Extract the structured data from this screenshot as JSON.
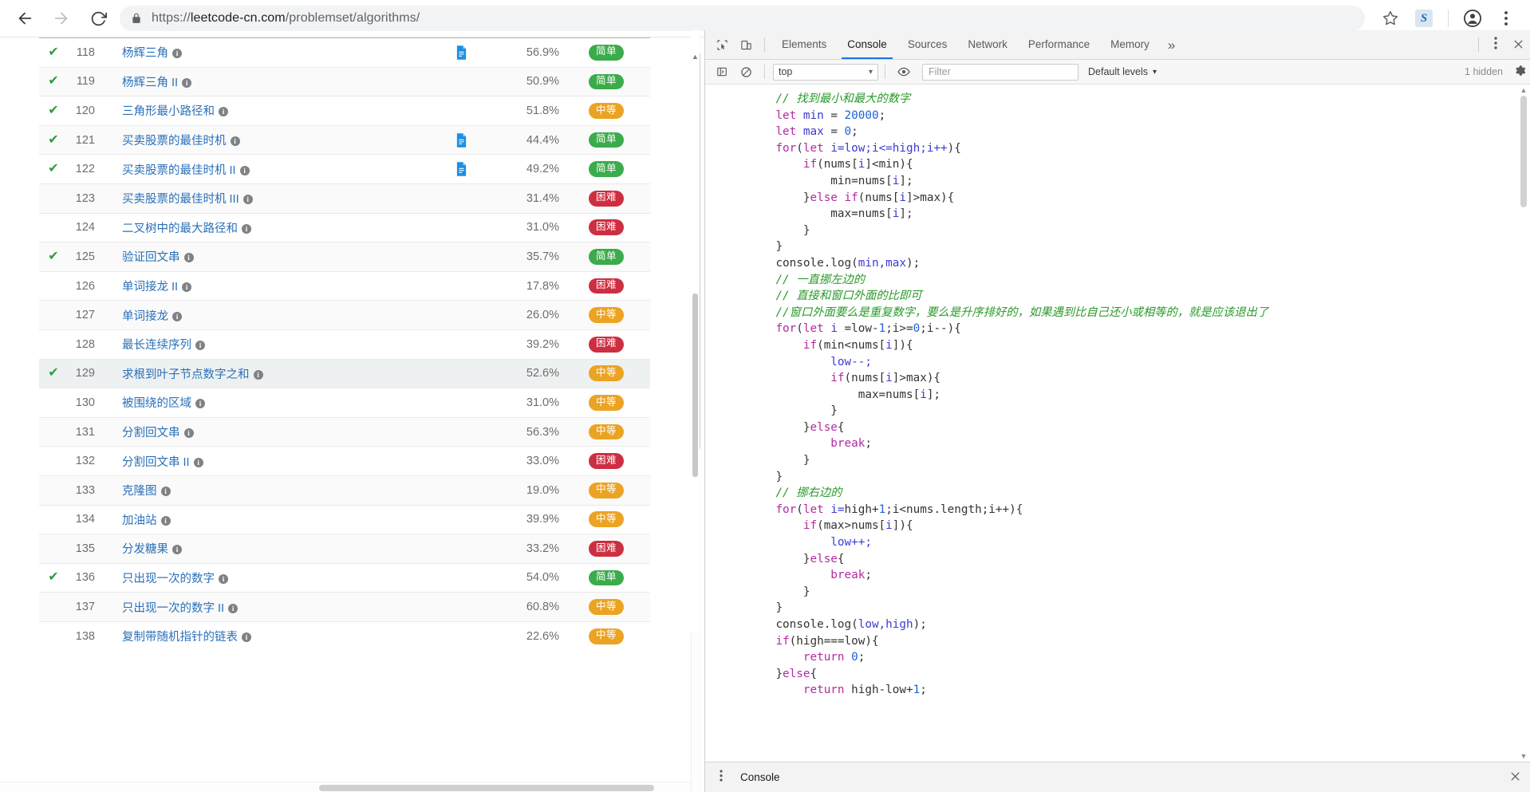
{
  "browser": {
    "back_icon": "back-arrow-icon",
    "forward_icon": "forward-arrow-icon",
    "reload_icon": "reload-icon",
    "lock_icon": "lock-icon",
    "url_scheme": "https://",
    "url_host": "leetcode-cn.com",
    "url_path": "/problemset/algorithms/",
    "bookmark_icon": "star-icon",
    "extension_label": "S",
    "profile_icon": "account-icon",
    "menu_icon": "three-dot-menu-icon"
  },
  "problems": {
    "columns": [
      "status",
      "id",
      "title",
      "solution",
      "acceptance",
      "difficulty"
    ],
    "rows": [
      {
        "solved": true,
        "id": "118",
        "title": "杨辉三角",
        "has_solution": true,
        "rate": "56.9%",
        "difficulty": "简单",
        "level": "easy"
      },
      {
        "solved": true,
        "id": "119",
        "title": "杨辉三角 II",
        "has_solution": false,
        "rate": "50.9%",
        "difficulty": "简单",
        "level": "easy"
      },
      {
        "solved": true,
        "id": "120",
        "title": "三角形最小路径和",
        "has_solution": false,
        "rate": "51.8%",
        "difficulty": "中等",
        "level": "medium"
      },
      {
        "solved": true,
        "id": "121",
        "title": "买卖股票的最佳时机",
        "has_solution": true,
        "rate": "44.4%",
        "difficulty": "简单",
        "level": "easy"
      },
      {
        "solved": true,
        "id": "122",
        "title": "买卖股票的最佳时机 II",
        "has_solution": true,
        "rate": "49.2%",
        "difficulty": "简单",
        "level": "easy"
      },
      {
        "solved": false,
        "id": "123",
        "title": "买卖股票的最佳时机 III",
        "has_solution": false,
        "rate": "31.4%",
        "difficulty": "困难",
        "level": "hard"
      },
      {
        "solved": false,
        "id": "124",
        "title": "二叉树中的最大路径和",
        "has_solution": false,
        "rate": "31.0%",
        "difficulty": "困难",
        "level": "hard"
      },
      {
        "solved": true,
        "id": "125",
        "title": "验证回文串",
        "has_solution": false,
        "rate": "35.7%",
        "difficulty": "简单",
        "level": "easy"
      },
      {
        "solved": false,
        "id": "126",
        "title": "单词接龙 II",
        "has_solution": false,
        "rate": "17.8%",
        "difficulty": "困难",
        "level": "hard"
      },
      {
        "solved": false,
        "id": "127",
        "title": "单词接龙",
        "has_solution": false,
        "rate": "26.0%",
        "difficulty": "中等",
        "level": "medium"
      },
      {
        "solved": false,
        "id": "128",
        "title": "最长连续序列",
        "has_solution": false,
        "rate": "39.2%",
        "difficulty": "困难",
        "level": "hard"
      },
      {
        "solved": true,
        "id": "129",
        "title": "求根到叶子节点数字之和",
        "has_solution": false,
        "rate": "52.6%",
        "difficulty": "中等",
        "level": "medium"
      },
      {
        "solved": false,
        "id": "130",
        "title": "被围绕的区域",
        "has_solution": false,
        "rate": "31.0%",
        "difficulty": "中等",
        "level": "medium"
      },
      {
        "solved": false,
        "id": "131",
        "title": "分割回文串",
        "has_solution": false,
        "rate": "56.3%",
        "difficulty": "中等",
        "level": "medium"
      },
      {
        "solved": false,
        "id": "132",
        "title": "分割回文串 II",
        "has_solution": false,
        "rate": "33.0%",
        "difficulty": "困难",
        "level": "hard"
      },
      {
        "solved": false,
        "id": "133",
        "title": "克隆图",
        "has_solution": false,
        "rate": "19.0%",
        "difficulty": "中等",
        "level": "medium"
      },
      {
        "solved": false,
        "id": "134",
        "title": "加油站",
        "has_solution": false,
        "rate": "39.9%",
        "difficulty": "中等",
        "level": "medium"
      },
      {
        "solved": false,
        "id": "135",
        "title": "分发糖果",
        "has_solution": false,
        "rate": "33.2%",
        "difficulty": "困难",
        "level": "hard"
      },
      {
        "solved": true,
        "id": "136",
        "title": "只出现一次的数字",
        "has_solution": false,
        "rate": "54.0%",
        "difficulty": "简单",
        "level": "easy"
      },
      {
        "solved": false,
        "id": "137",
        "title": "只出现一次的数字 II",
        "has_solution": false,
        "rate": "60.8%",
        "difficulty": "中等",
        "level": "medium"
      },
      {
        "solved": false,
        "id": "138",
        "title": "复制带随机指针的链表",
        "has_solution": false,
        "rate": "22.6%",
        "difficulty": "中等",
        "level": "medium"
      }
    ],
    "colors": {
      "easy": "#3bab4b",
      "medium": "#eba324",
      "hard": "#cc2f41",
      "title_link": "#2a70b8",
      "check": "#2e9c3f"
    }
  },
  "devtools": {
    "inspect_icon": "cursor-inspect-icon",
    "device_icon": "device-toolbar-icon",
    "tabs": [
      {
        "label": "Elements",
        "active": false
      },
      {
        "label": "Console",
        "active": true
      },
      {
        "label": "Sources",
        "active": false
      },
      {
        "label": "Network",
        "active": false
      },
      {
        "label": "Performance",
        "active": false
      },
      {
        "label": "Memory",
        "active": false
      }
    ],
    "more_tabs_icon": "chevron-double-right-icon",
    "settings_kebab_icon": "vertical-dots-icon",
    "close_icon": "close-icon",
    "toolbar": {
      "sidebar_icon": "console-sidebar-icon",
      "clear_icon": "clear-console-icon",
      "context": "top",
      "context_caret": "▾",
      "eye_icon": "live-expression-icon",
      "filter_placeholder": "Filter",
      "levels_label": "Default levels",
      "levels_caret": "▾",
      "hidden_label": "1 hidden",
      "gear_icon": "settings-gear-icon"
    },
    "code_lines": [
      {
        "indent": 4,
        "parts": [
          {
            "t": "// 找到最小和最大的数字",
            "c": "cm"
          }
        ]
      },
      {
        "indent": 4,
        "parts": [
          {
            "t": "let ",
            "c": "kw"
          },
          {
            "t": "min ",
            "c": "nm"
          },
          {
            "t": "= ",
            "c": "pl"
          },
          {
            "t": "20000",
            "c": "num"
          },
          {
            "t": ";",
            "c": "pl"
          }
        ]
      },
      {
        "indent": 4,
        "parts": [
          {
            "t": "let ",
            "c": "kw"
          },
          {
            "t": "max ",
            "c": "nm"
          },
          {
            "t": "= ",
            "c": "pl"
          },
          {
            "t": "0",
            "c": "num"
          },
          {
            "t": ";",
            "c": "pl"
          }
        ]
      },
      {
        "indent": 4,
        "parts": [
          {
            "t": "for",
            "c": "kw"
          },
          {
            "t": "(",
            "c": "pl"
          },
          {
            "t": "let ",
            "c": "kw"
          },
          {
            "t": "i=",
            "c": "nm"
          },
          {
            "t": "low;i<=high;i++",
            "c": "nm"
          },
          {
            "t": "){",
            "c": "pl"
          }
        ]
      },
      {
        "indent": 8,
        "parts": [
          {
            "t": "if",
            "c": "kw"
          },
          {
            "t": "(nums[",
            "c": "pl"
          },
          {
            "t": "i",
            "c": "nm"
          },
          {
            "t": "]<min){",
            "c": "pl"
          }
        ]
      },
      {
        "indent": 12,
        "parts": [
          {
            "t": "min=nums[",
            "c": "pl"
          },
          {
            "t": "i",
            "c": "nm"
          },
          {
            "t": "];",
            "c": "pl"
          }
        ]
      },
      {
        "indent": 8,
        "parts": [
          {
            "t": "}",
            "c": "pl"
          },
          {
            "t": "else if",
            "c": "kw"
          },
          {
            "t": "(nums[",
            "c": "pl"
          },
          {
            "t": "i",
            "c": "nm"
          },
          {
            "t": "]>max){",
            "c": "pl"
          }
        ]
      },
      {
        "indent": 12,
        "parts": [
          {
            "t": "max=nums[",
            "c": "pl"
          },
          {
            "t": "i",
            "c": "nm"
          },
          {
            "t": "];",
            "c": "pl"
          }
        ]
      },
      {
        "indent": 8,
        "parts": [
          {
            "t": "}",
            "c": "pl"
          }
        ]
      },
      {
        "indent": 4,
        "parts": [
          {
            "t": "}",
            "c": "pl"
          }
        ]
      },
      {
        "indent": 0,
        "parts": [
          {
            "t": "",
            "c": "pl"
          }
        ]
      },
      {
        "indent": 4,
        "parts": [
          {
            "t": "console.log(",
            "c": "pl"
          },
          {
            "t": "min,max",
            "c": "nm"
          },
          {
            "t": ");",
            "c": "pl"
          }
        ]
      },
      {
        "indent": 0,
        "parts": [
          {
            "t": "",
            "c": "pl"
          }
        ]
      },
      {
        "indent": 0,
        "parts": [
          {
            "t": "",
            "c": "pl"
          }
        ]
      },
      {
        "indent": 4,
        "parts": [
          {
            "t": "// 一直挪左边的",
            "c": "cm"
          }
        ]
      },
      {
        "indent": 4,
        "parts": [
          {
            "t": "// 直接和窗口外面的比即可",
            "c": "cm"
          }
        ]
      },
      {
        "indent": 4,
        "parts": [
          {
            "t": "//窗口外面要么是重复数字，要么是升序排好的，如果遇到比自己还小或相等的，就是应该退出了",
            "c": "cm"
          }
        ]
      },
      {
        "indent": 4,
        "parts": [
          {
            "t": "for",
            "c": "kw"
          },
          {
            "t": "(",
            "c": "pl"
          },
          {
            "t": "let ",
            "c": "kw"
          },
          {
            "t": "i ",
            "c": "nm"
          },
          {
            "t": "=low-",
            "c": "pl"
          },
          {
            "t": "1",
            "c": "num"
          },
          {
            "t": ";i>=",
            "c": "pl"
          },
          {
            "t": "0",
            "c": "num"
          },
          {
            "t": ";i--){",
            "c": "pl"
          }
        ]
      },
      {
        "indent": 8,
        "parts": [
          {
            "t": "if",
            "c": "kw"
          },
          {
            "t": "(min<nums[",
            "c": "pl"
          },
          {
            "t": "i",
            "c": "nm"
          },
          {
            "t": "]){",
            "c": "pl"
          }
        ]
      },
      {
        "indent": 12,
        "parts": [
          {
            "t": "low--;",
            "c": "nm"
          }
        ]
      },
      {
        "indent": 12,
        "parts": [
          {
            "t": "if",
            "c": "kw"
          },
          {
            "t": "(nums[",
            "c": "pl"
          },
          {
            "t": "i",
            "c": "nm"
          },
          {
            "t": "]>max){",
            "c": "pl"
          }
        ]
      },
      {
        "indent": 16,
        "parts": [
          {
            "t": "max=nums[",
            "c": "pl"
          },
          {
            "t": "i",
            "c": "nm"
          },
          {
            "t": "];",
            "c": "pl"
          }
        ]
      },
      {
        "indent": 12,
        "parts": [
          {
            "t": "}",
            "c": "pl"
          }
        ]
      },
      {
        "indent": 8,
        "parts": [
          {
            "t": "}",
            "c": "pl"
          },
          {
            "t": "else",
            "c": "kw"
          },
          {
            "t": "{",
            "c": "pl"
          }
        ]
      },
      {
        "indent": 12,
        "parts": [
          {
            "t": "break",
            "c": "kw"
          },
          {
            "t": ";",
            "c": "pl"
          }
        ]
      },
      {
        "indent": 8,
        "parts": [
          {
            "t": "}",
            "c": "pl"
          }
        ]
      },
      {
        "indent": 4,
        "parts": [
          {
            "t": "}",
            "c": "pl"
          }
        ]
      },
      {
        "indent": 0,
        "parts": [
          {
            "t": "",
            "c": "pl"
          }
        ]
      },
      {
        "indent": 0,
        "parts": [
          {
            "t": "",
            "c": "pl"
          }
        ]
      },
      {
        "indent": 4,
        "parts": [
          {
            "t": "// 挪右边的",
            "c": "cm"
          }
        ]
      },
      {
        "indent": 4,
        "parts": [
          {
            "t": "for",
            "c": "kw"
          },
          {
            "t": "(",
            "c": "pl"
          },
          {
            "t": "let ",
            "c": "kw"
          },
          {
            "t": "i=",
            "c": "nm"
          },
          {
            "t": "high+",
            "c": "pl"
          },
          {
            "t": "1",
            "c": "num"
          },
          {
            "t": ";i<nums.length;i++){",
            "c": "pl"
          }
        ]
      },
      {
        "indent": 8,
        "parts": [
          {
            "t": "if",
            "c": "kw"
          },
          {
            "t": "(max>nums[",
            "c": "pl"
          },
          {
            "t": "i",
            "c": "nm"
          },
          {
            "t": "]){",
            "c": "pl"
          }
        ]
      },
      {
        "indent": 12,
        "parts": [
          {
            "t": "low++;",
            "c": "nm"
          }
        ]
      },
      {
        "indent": 8,
        "parts": [
          {
            "t": "}",
            "c": "pl"
          },
          {
            "t": "else",
            "c": "kw"
          },
          {
            "t": "{",
            "c": "pl"
          }
        ]
      },
      {
        "indent": 12,
        "parts": [
          {
            "t": "break",
            "c": "kw"
          },
          {
            "t": ";",
            "c": "pl"
          }
        ]
      },
      {
        "indent": 8,
        "parts": [
          {
            "t": "}",
            "c": "pl"
          }
        ]
      },
      {
        "indent": 4,
        "parts": [
          {
            "t": "}",
            "c": "pl"
          }
        ]
      },
      {
        "indent": 0,
        "parts": [
          {
            "t": "",
            "c": "pl"
          }
        ]
      },
      {
        "indent": 4,
        "parts": [
          {
            "t": "console.log(",
            "c": "pl"
          },
          {
            "t": "low,high",
            "c": "nm"
          },
          {
            "t": ");",
            "c": "pl"
          }
        ]
      },
      {
        "indent": 0,
        "parts": [
          {
            "t": "",
            "c": "pl"
          }
        ]
      },
      {
        "indent": 4,
        "parts": [
          {
            "t": "if",
            "c": "kw"
          },
          {
            "t": "(high===low){",
            "c": "pl"
          }
        ]
      },
      {
        "indent": 8,
        "parts": [
          {
            "t": "return ",
            "c": "kw"
          },
          {
            "t": "0",
            "c": "num"
          },
          {
            "t": ";",
            "c": "pl"
          }
        ]
      },
      {
        "indent": 4,
        "parts": [
          {
            "t": "}",
            "c": "pl"
          },
          {
            "t": "else",
            "c": "kw"
          },
          {
            "t": "{",
            "c": "pl"
          }
        ]
      },
      {
        "indent": 8,
        "parts": [
          {
            "t": "return ",
            "c": "kw"
          },
          {
            "t": "high-low+",
            "c": "pl"
          },
          {
            "t": "1",
            "c": "num"
          },
          {
            "t": ";",
            "c": "pl"
          }
        ]
      }
    ],
    "drawer": {
      "kebab_icon": "vertical-dots-icon",
      "tab_label": "Console",
      "close_icon": "close-icon"
    }
  }
}
